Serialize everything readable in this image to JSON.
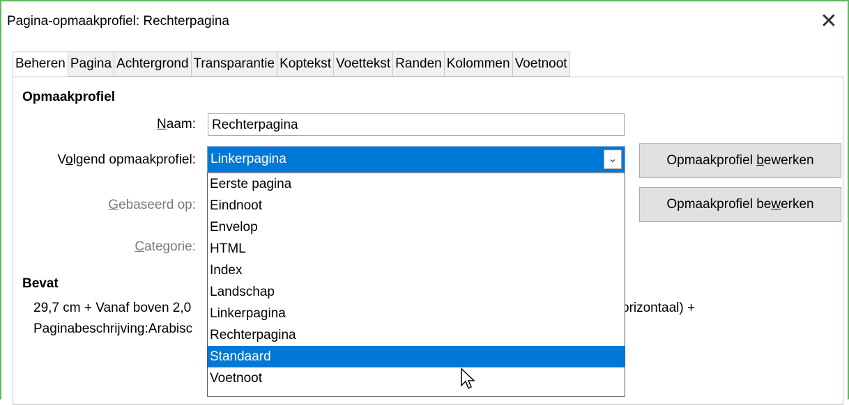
{
  "window": {
    "title": "Pagina-opmaakprofiel: Rechterpagina",
    "close_symbol": "✕"
  },
  "tabs": [
    "Beheren",
    "Pagina",
    "Achtergrond",
    "Transparantie",
    "Koptekst",
    "Voettekst",
    "Randen",
    "Kolommen",
    "Voetnoot"
  ],
  "active_tab": "Beheren",
  "section_style": {
    "title": "Opmaakprofiel"
  },
  "fields": {
    "name_label_u": "N",
    "name_label_rest": "aam:",
    "name_value": "Rechterpagina",
    "next_label_a": "V",
    "next_label_u": "o",
    "next_label_b": "lgend opmaakprofiel:",
    "next_value": "Linkerpagina",
    "based_label_u": "G",
    "based_label_rest": "ebaseerd op:",
    "category_label_u": "C",
    "category_label_rest": "ategorie:"
  },
  "buttons": {
    "edit1_a": "Opmaakprofiel ",
    "edit1_u": "b",
    "edit1_b": "ewerken",
    "edit2_a": "Opmaakprofiel be",
    "edit2_u": "w",
    "edit2_b": "erken"
  },
  "contains": {
    "title": "Bevat",
    "line1_a": "29,7 cm + Vanaf boven 2,0",
    "line1_b": "orizontaal) +",
    "line2": "Paginabeschrijving:Arabisc"
  },
  "dropdown_options": [
    "Eerste pagina",
    "Eindnoot",
    "Envelop",
    "HTML",
    "Index",
    "Landschap",
    "Linkerpagina",
    "Rechterpagina",
    "Standaard",
    "Voetnoot"
  ],
  "dropdown_highlighted": "Standaard",
  "colors": {
    "accent": "#0078d7",
    "frame": "#5cb85c"
  }
}
